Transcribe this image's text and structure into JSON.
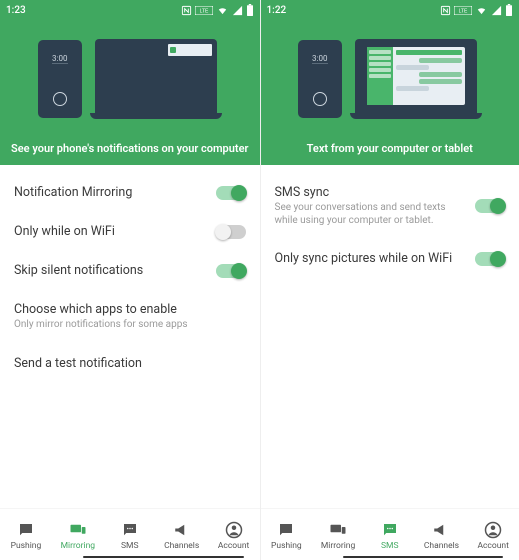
{
  "accent": "#40a860",
  "screens": [
    {
      "status_time": "1:23",
      "hero_caption": "See your phone's notifications on your computer",
      "phone_time": "3:00",
      "rows": [
        {
          "title": "Notification Mirroring",
          "sub": "",
          "toggle": "on"
        },
        {
          "title": "Only while on WiFi",
          "sub": "",
          "toggle": "off"
        },
        {
          "title": "Skip silent notifications",
          "sub": "",
          "toggle": "on"
        },
        {
          "title": "Choose which apps to enable",
          "sub": "Only mirror notifications for some apps",
          "toggle": ""
        },
        {
          "title": "Send a test notification",
          "sub": "",
          "toggle": ""
        }
      ],
      "nav_active_index": 1
    },
    {
      "status_time": "1:22",
      "hero_caption": "Text from your computer or tablet",
      "phone_time": "3:00",
      "rows": [
        {
          "title": "SMS sync",
          "sub": "See your conversations and send texts while using your computer or tablet.",
          "toggle": "on"
        },
        {
          "title": "Only sync pictures while on WiFi",
          "sub": "",
          "toggle": "on"
        }
      ],
      "nav_active_index": 2
    }
  ],
  "nav": [
    {
      "label": "Pushing",
      "icon": "chat"
    },
    {
      "label": "Mirroring",
      "icon": "devices"
    },
    {
      "label": "SMS",
      "icon": "sms"
    },
    {
      "label": "Channels",
      "icon": "megaphone"
    },
    {
      "label": "Account",
      "icon": "account"
    }
  ]
}
